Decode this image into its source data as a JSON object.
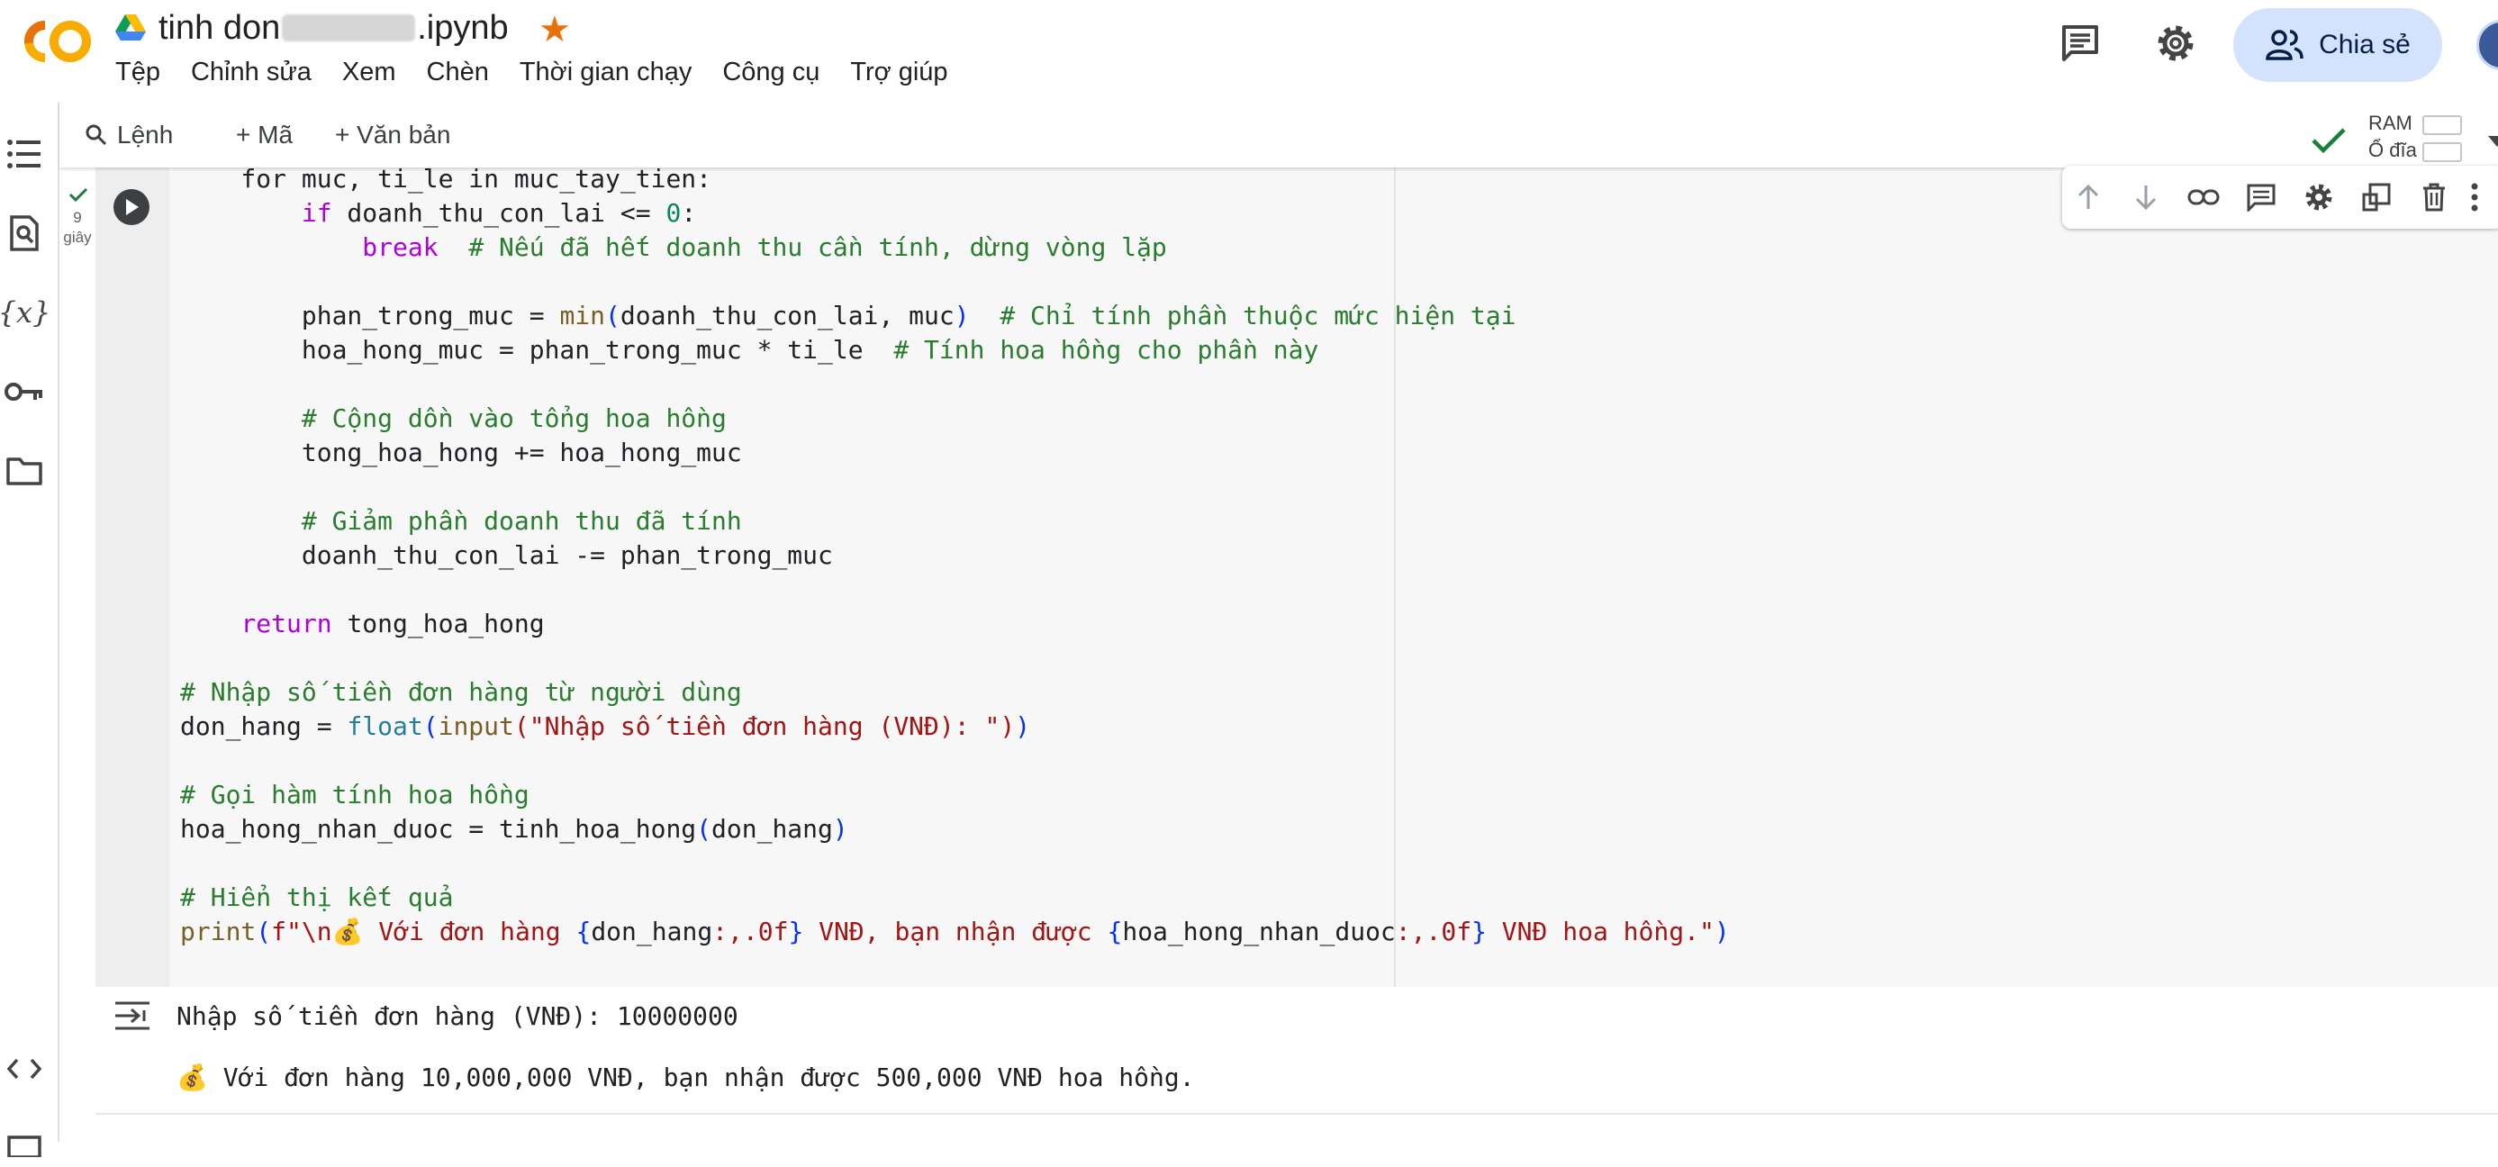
{
  "header": {
    "title_prefix": "tinh don",
    "title_suffix": ".ipynb",
    "menu": [
      "Tệp",
      "Chỉnh sửa",
      "Xem",
      "Chèn",
      "Thời gian chạy",
      "Công cụ",
      "Trợ giúp"
    ],
    "share_label": "Chia sẻ",
    "brand_color": "#f9ab00"
  },
  "toolbar": {
    "command_label": "Lệnh",
    "code_label": "+ Mã",
    "text_label": "+ Văn bản",
    "ram_label": "RAM",
    "disk_label": "Ổ đĩa"
  },
  "cell": {
    "exec_time": "9",
    "exec_unit": "giây",
    "code_lines": [
      "    for muc, ti_le in muc_tay_tien:",
      "        if doanh_thu_con_lai <= 0:",
      "            break  # Nếu đã hết doanh thu cần tính, dừng vòng lặp",
      "",
      "        phan_trong_muc = min(doanh_thu_con_lai, muc)  # Chỉ tính phần thuộc mức hiện tại",
      "        hoa_hong_muc = phan_trong_muc * ti_le  # Tính hoa hồng cho phần này",
      "",
      "        # Cộng dồn vào tổng hoa hồng",
      "        tong_hoa_hong += hoa_hong_muc",
      "",
      "        # Giảm phần doanh thu đã tính",
      "        doanh_thu_con_lai -= phan_trong_muc",
      "",
      "    return tong_hoa_hong",
      "",
      "# Nhập số tiền đơn hàng từ người dùng",
      "don_hang = float(input(\"Nhập số tiền đơn hàng (VNĐ): \"))",
      "",
      "# Gọi hàm tính hoa hồng",
      "hoa_hong_nhan_duoc = tinh_hoa_hong(don_hang)",
      "",
      "# Hiển thị kết quả",
      "print(f\"\\n💰 Với đơn hàng {don_hang:,.0f} VNĐ, bạn nhận được {hoa_hong_nhan_duoc:,.0f} VNĐ hoa hồng.\")"
    ]
  },
  "output": {
    "line1": "Nhập số tiền đơn hàng (VNĐ): 10000000",
    "line2": "💰 Với đơn hàng 10,000,000 VNĐ, bạn nhận được 500,000 VNĐ hoa hồng."
  }
}
